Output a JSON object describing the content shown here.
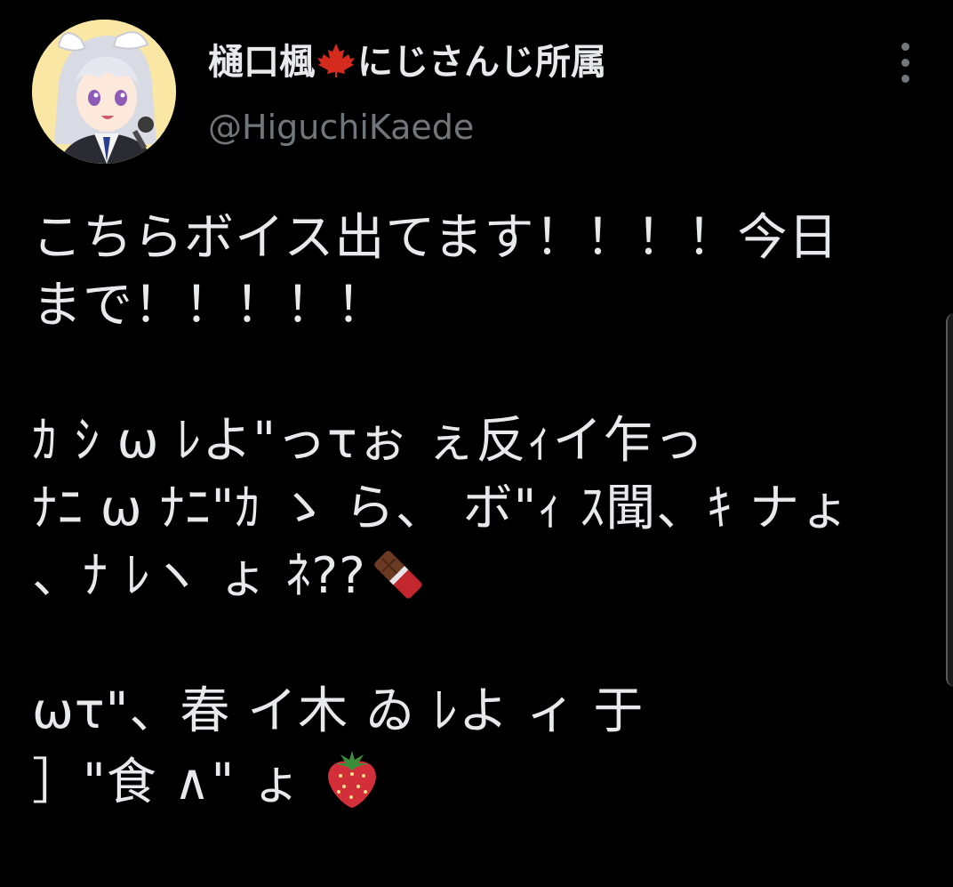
{
  "user": {
    "display_name_prefix": "樋口楓",
    "display_name_suffix": "にじさんじ所属",
    "handle": "@HiguchiKaede",
    "flag_icon": "maple-leaf-icon"
  },
  "tweet": {
    "lines": [
      "こちらボイス出てます！！！！今日",
      "まで！！！！！",
      "",
      " ｶ ｼ ω ﾚよ\"っτぉ ぇ反ｨイ乍っ",
      "ﾅﾆ ω ﾅﾆ\"ｶ ゝ ら、 ボ\"ｨ ｽ聞、ｷ ナょ",
      "、ﾅ ﾚヽ ょ ﾈ??",
      "",
      " ωτ\"、春 イ木 ゐ ﾚよ ィ 于",
      "］\"食 ∧\" ょ "
    ],
    "emoji_line6": "chocolate-bar-icon",
    "emoji_line9": "strawberry-icon"
  },
  "colors": {
    "background": "#000000",
    "text": "#e7e9ea",
    "secondary": "#71767b",
    "flag_red": "#d52b1e"
  }
}
